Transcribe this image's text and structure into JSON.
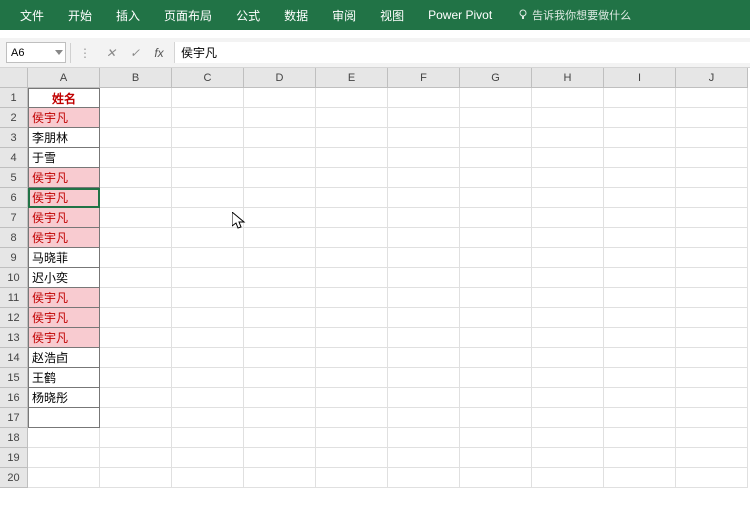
{
  "ribbon": {
    "tabs": [
      "文件",
      "开始",
      "插入",
      "页面布局",
      "公式",
      "数据",
      "审阅",
      "视图",
      "Power Pivot"
    ],
    "tellMe": "告诉我你想要做什么"
  },
  "formulaBar": {
    "nameBox": "A6",
    "cancel": "✕",
    "confirm": "✓",
    "fx": "fx",
    "value": "侯宇凡"
  },
  "grid": {
    "columns": [
      "A",
      "B",
      "C",
      "D",
      "E",
      "F",
      "G",
      "H",
      "I",
      "J"
    ],
    "rowCount": 20,
    "selectedRow": 6,
    "header": "姓名",
    "data": [
      {
        "v": "侯宇凡",
        "hl": true
      },
      {
        "v": "李朋林",
        "hl": false
      },
      {
        "v": "于雪",
        "hl": false
      },
      {
        "v": "侯宇凡",
        "hl": true
      },
      {
        "v": "侯宇凡",
        "hl": true
      },
      {
        "v": "侯宇凡",
        "hl": true
      },
      {
        "v": "侯宇凡",
        "hl": true
      },
      {
        "v": "马晓菲",
        "hl": false
      },
      {
        "v": "迟小奕",
        "hl": false
      },
      {
        "v": "侯宇凡",
        "hl": true
      },
      {
        "v": "侯宇凡",
        "hl": true
      },
      {
        "v": "侯宇凡",
        "hl": true
      },
      {
        "v": "赵浩卣",
        "hl": false
      },
      {
        "v": "王鹤",
        "hl": false
      },
      {
        "v": "杨晓彤",
        "hl": false
      }
    ]
  }
}
